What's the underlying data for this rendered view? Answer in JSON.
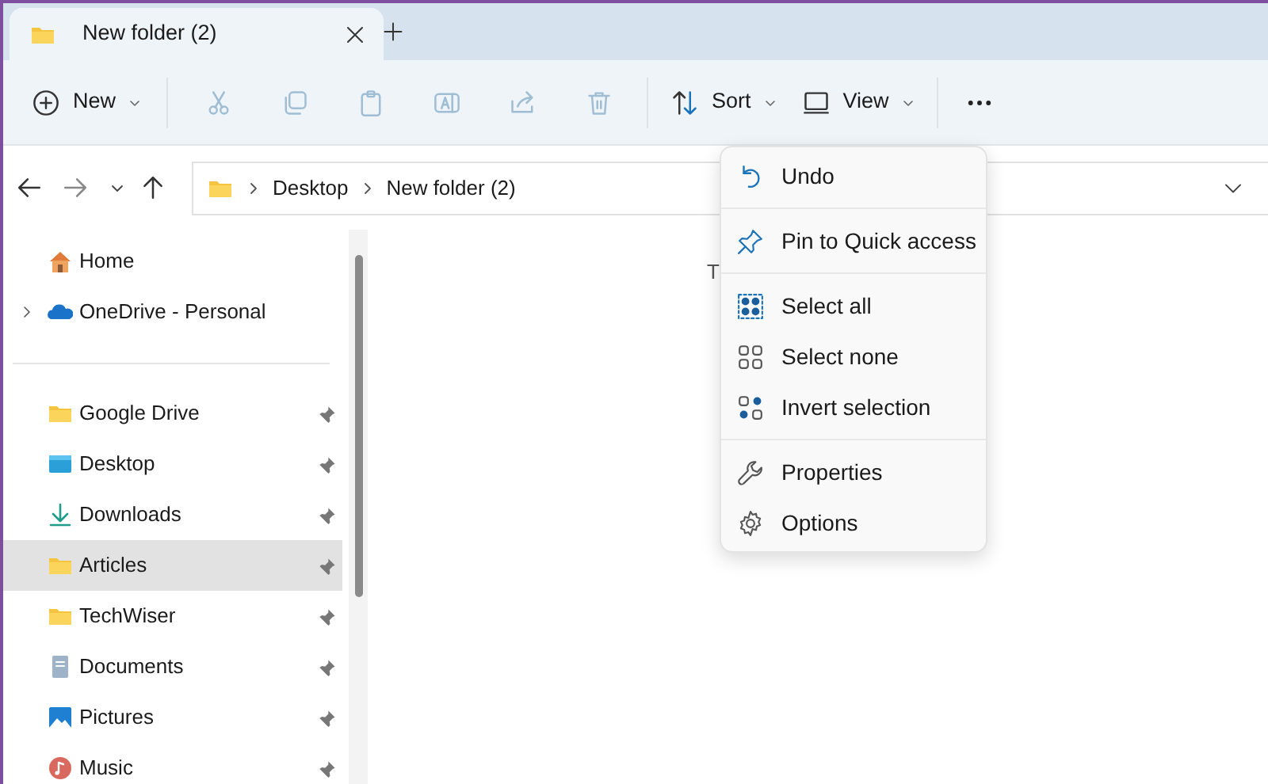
{
  "tab": {
    "title": "New folder (2)",
    "selected": true
  },
  "toolbar": [
    [
      {
        "kind": "new",
        "label": "New",
        "dropdown": true,
        "disabled": false
      }
    ],
    [
      {
        "kind": "cut",
        "disabled": true
      },
      {
        "kind": "copy",
        "disabled": true
      },
      {
        "kind": "paste",
        "disabled": true
      },
      {
        "kind": "rename",
        "disabled": true
      },
      {
        "kind": "share",
        "disabled": true
      },
      {
        "kind": "delete",
        "disabled": true
      }
    ],
    [
      {
        "kind": "sort",
        "label": "Sort",
        "dropdown": true,
        "disabled": false
      },
      {
        "kind": "view",
        "label": "View",
        "dropdown": true,
        "disabled": false
      }
    ],
    [
      {
        "kind": "more",
        "disabled": false
      }
    ]
  ],
  "breadcrumb": [
    "Desktop",
    "New folder (2)"
  ],
  "sidebar": [
    [
      {
        "kind": "home",
        "label": "Home",
        "expandable": false,
        "pinned": false,
        "selected": false
      },
      {
        "kind": "onedrive",
        "label": "OneDrive - Personal",
        "expandable": true,
        "pinned": false,
        "selected": false
      }
    ],
    [
      {
        "kind": "folder",
        "label": "Google Drive",
        "expandable": false,
        "pinned": true,
        "selected": false
      },
      {
        "kind": "desktop",
        "label": "Desktop",
        "expandable": false,
        "pinned": true,
        "selected": false
      },
      {
        "kind": "downloads",
        "label": "Downloads",
        "expandable": false,
        "pinned": true,
        "selected": false
      },
      {
        "kind": "folder",
        "label": "Articles",
        "expandable": false,
        "pinned": true,
        "selected": true
      },
      {
        "kind": "folder",
        "label": "TechWiser",
        "expandable": false,
        "pinned": true,
        "selected": false
      },
      {
        "kind": "documents",
        "label": "Documents",
        "expandable": false,
        "pinned": true,
        "selected": false
      },
      {
        "kind": "pictures",
        "label": "Pictures",
        "expandable": false,
        "pinned": true,
        "selected": false
      },
      {
        "kind": "music",
        "label": "Music",
        "expandable": false,
        "pinned": true,
        "selected": false
      }
    ]
  ],
  "content": {
    "text": "T"
  },
  "menu": [
    [
      {
        "kind": "undo",
        "label": "Undo"
      }
    ],
    [
      {
        "kind": "pin",
        "label": "Pin to Quick access"
      }
    ],
    [
      {
        "kind": "selectall",
        "label": "Select all"
      },
      {
        "kind": "selectnone",
        "label": "Select none"
      },
      {
        "kind": "invert",
        "label": "Invert selection"
      }
    ],
    [
      {
        "kind": "properties",
        "label": "Properties"
      },
      {
        "kind": "options",
        "label": "Options"
      }
    ]
  ]
}
